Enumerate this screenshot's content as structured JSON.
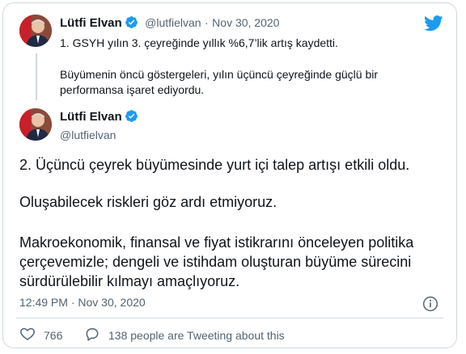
{
  "parent_tweet": {
    "author_name": "Lütfi Elvan",
    "handle": "@lutfielvan",
    "separator": "·",
    "date": "Nov 30, 2020",
    "paragraphs": [
      "1. GSYH yılın 3. çeyreğinde yıllık %6,7’lik artış kaydetti.",
      "Büyümenin öncü göstergeleri, yılın üçüncü çeyreğinde güçlü bir",
      "performansa işaret ediyordu."
    ]
  },
  "main_tweet": {
    "author_name": "Lütfi Elvan",
    "handle": "@lutfielvan",
    "paragraphs": [
      "2. Üçüncü çeyrek büyümesinde yurt içi talep artışı etkili oldu.",
      "Oluşabilecek riskleri göz ardı etmiyoruz.",
      "Makroekonomik, finansal ve fiyat istikrarını önceleyen politika",
      "çerçevemizle; dengeli ve istihdam oluşturan büyüme sürecini",
      "sürdürülebilir kılmayı amaçlıyoruz."
    ],
    "time": "12:49 PM",
    "separator": "·",
    "date": "Nov 30, 2020"
  },
  "actions": {
    "likes": "766",
    "retweet_text": "138 people are Tweeting about this"
  },
  "colors": {
    "twitter_blue": "#1d9bf0",
    "text_primary": "#0f1419",
    "text_secondary": "#536471",
    "border": "#cfd9de"
  },
  "icons": [
    "twitter-bird-icon",
    "verified-badge-icon",
    "info-icon",
    "heart-icon",
    "speech-bubble-icon"
  ]
}
